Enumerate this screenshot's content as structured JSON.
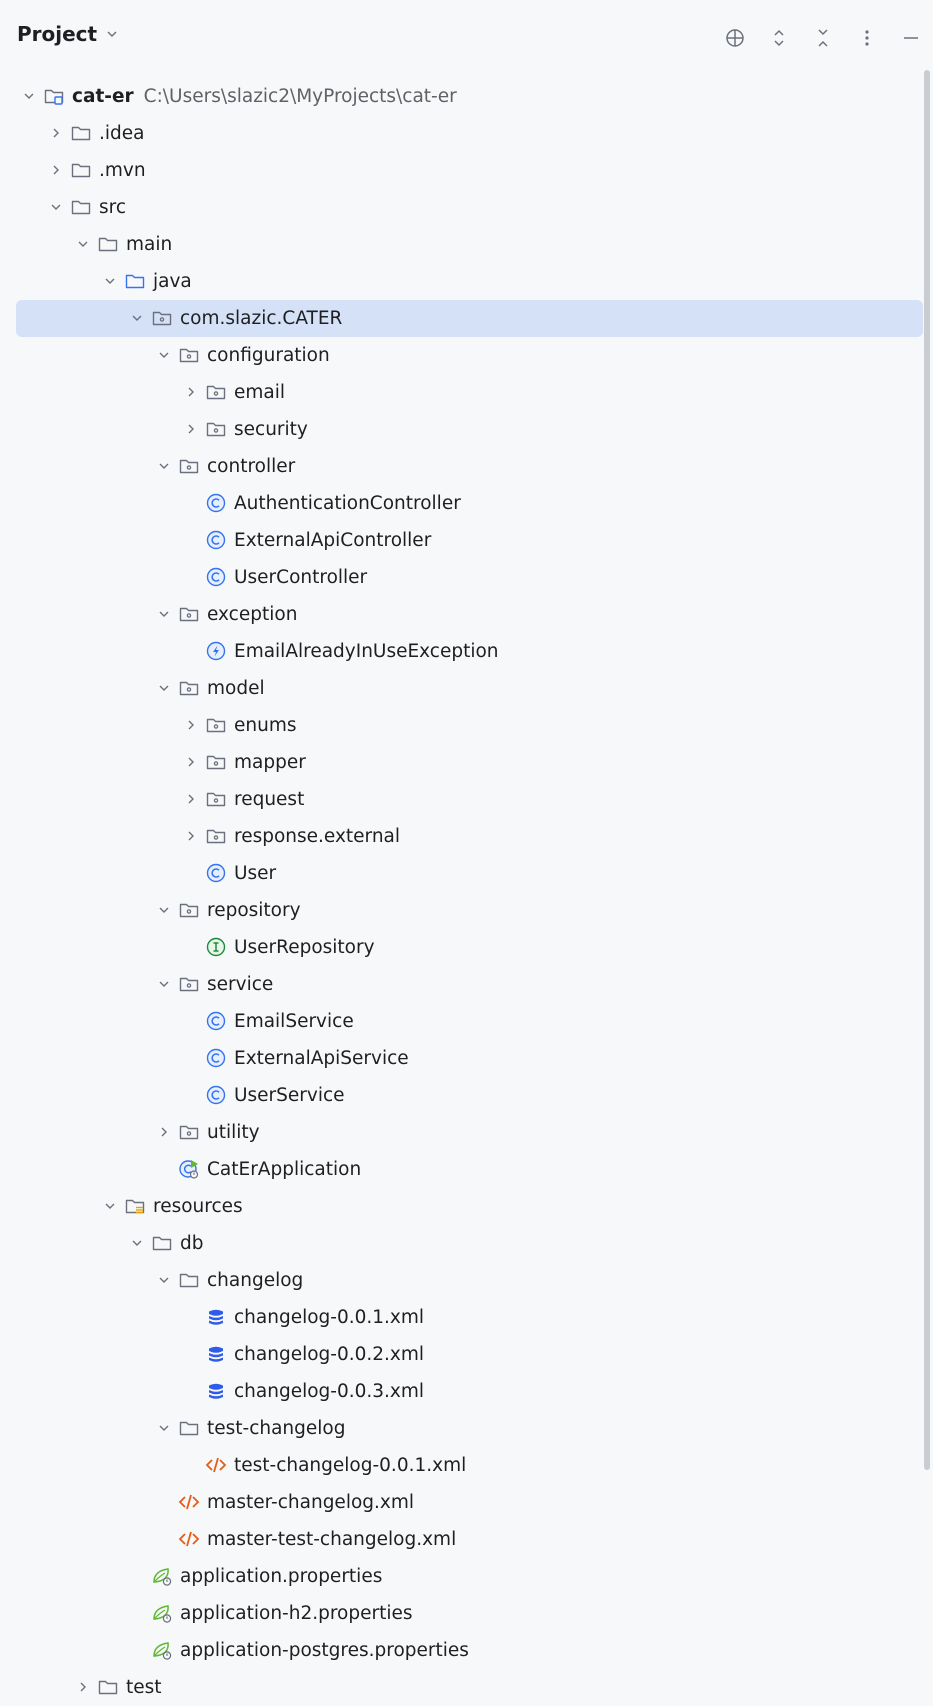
{
  "header": {
    "title": "Project"
  },
  "tree": [
    {
      "depth": 0,
      "arrow": "down",
      "icon": "project-module",
      "label": "cat-er",
      "path": "C:\\Users\\slazic2\\MyProjects\\cat-er",
      "bold": true
    },
    {
      "depth": 1,
      "arrow": "right",
      "icon": "folder",
      "label": ".idea"
    },
    {
      "depth": 1,
      "arrow": "right",
      "icon": "folder",
      "label": ".mvn"
    },
    {
      "depth": 1,
      "arrow": "down",
      "icon": "folder",
      "label": "src"
    },
    {
      "depth": 2,
      "arrow": "down",
      "icon": "folder",
      "label": "main"
    },
    {
      "depth": 3,
      "arrow": "down",
      "icon": "source-folder",
      "label": "java"
    },
    {
      "depth": 4,
      "arrow": "down",
      "icon": "package",
      "label": "com.slazic.CATER",
      "selected": true
    },
    {
      "depth": 5,
      "arrow": "down",
      "icon": "package",
      "label": "configuration"
    },
    {
      "depth": 6,
      "arrow": "right",
      "icon": "package",
      "label": "email"
    },
    {
      "depth": 6,
      "arrow": "right",
      "icon": "package",
      "label": "security"
    },
    {
      "depth": 5,
      "arrow": "down",
      "icon": "package",
      "label": "controller"
    },
    {
      "depth": 6,
      "arrow": "none",
      "icon": "class",
      "label": "AuthenticationController"
    },
    {
      "depth": 6,
      "arrow": "none",
      "icon": "class",
      "label": "ExternalApiController"
    },
    {
      "depth": 6,
      "arrow": "none",
      "icon": "class",
      "label": "UserController"
    },
    {
      "depth": 5,
      "arrow": "down",
      "icon": "package",
      "label": "exception"
    },
    {
      "depth": 6,
      "arrow": "none",
      "icon": "exception-class",
      "label": "EmailAlreadyInUseException"
    },
    {
      "depth": 5,
      "arrow": "down",
      "icon": "package",
      "label": "model"
    },
    {
      "depth": 6,
      "arrow": "right",
      "icon": "package",
      "label": "enums"
    },
    {
      "depth": 6,
      "arrow": "right",
      "icon": "package",
      "label": "mapper"
    },
    {
      "depth": 6,
      "arrow": "right",
      "icon": "package",
      "label": "request"
    },
    {
      "depth": 6,
      "arrow": "right",
      "icon": "package",
      "label": "response.external"
    },
    {
      "depth": 6,
      "arrow": "none",
      "icon": "class",
      "label": "User"
    },
    {
      "depth": 5,
      "arrow": "down",
      "icon": "package",
      "label": "repository"
    },
    {
      "depth": 6,
      "arrow": "none",
      "icon": "interface",
      "label": "UserRepository"
    },
    {
      "depth": 5,
      "arrow": "down",
      "icon": "package",
      "label": "service"
    },
    {
      "depth": 6,
      "arrow": "none",
      "icon": "class",
      "label": "EmailService"
    },
    {
      "depth": 6,
      "arrow": "none",
      "icon": "class",
      "label": "ExternalApiService"
    },
    {
      "depth": 6,
      "arrow": "none",
      "icon": "class",
      "label": "UserService"
    },
    {
      "depth": 5,
      "arrow": "right",
      "icon": "package",
      "label": "utility"
    },
    {
      "depth": 5,
      "arrow": "none",
      "icon": "spring-boot-class",
      "label": "CatErApplication"
    },
    {
      "depth": 3,
      "arrow": "down",
      "icon": "resources-folder",
      "label": "resources"
    },
    {
      "depth": 4,
      "arrow": "down",
      "icon": "folder",
      "label": "db"
    },
    {
      "depth": 5,
      "arrow": "down",
      "icon": "folder",
      "label": "changelog"
    },
    {
      "depth": 6,
      "arrow": "none",
      "icon": "database-file",
      "label": "changelog-0.0.1.xml"
    },
    {
      "depth": 6,
      "arrow": "none",
      "icon": "database-file",
      "label": "changelog-0.0.2.xml"
    },
    {
      "depth": 6,
      "arrow": "none",
      "icon": "database-file",
      "label": "changelog-0.0.3.xml"
    },
    {
      "depth": 5,
      "arrow": "down",
      "icon": "folder",
      "label": "test-changelog"
    },
    {
      "depth": 6,
      "arrow": "none",
      "icon": "xml-file",
      "label": "test-changelog-0.0.1.xml"
    },
    {
      "depth": 5,
      "arrow": "none",
      "icon": "xml-file",
      "label": "master-changelog.xml"
    },
    {
      "depth": 5,
      "arrow": "none",
      "icon": "xml-file",
      "label": "master-test-changelog.xml"
    },
    {
      "depth": 4,
      "arrow": "none",
      "icon": "spring-properties-file",
      "label": "application.properties"
    },
    {
      "depth": 4,
      "arrow": "none",
      "icon": "spring-properties-file",
      "label": "application-h2.properties"
    },
    {
      "depth": 4,
      "arrow": "none",
      "icon": "spring-properties-file",
      "label": "application-postgres.properties"
    },
    {
      "depth": 2,
      "arrow": "right",
      "icon": "folder",
      "label": "test"
    }
  ],
  "colors": {
    "selection": "#d5e1f7",
    "class_blue": "#3574f0",
    "interface_green": "#208a3c",
    "xml_orange": "#e55b17",
    "spring_green": "#5fb832"
  }
}
